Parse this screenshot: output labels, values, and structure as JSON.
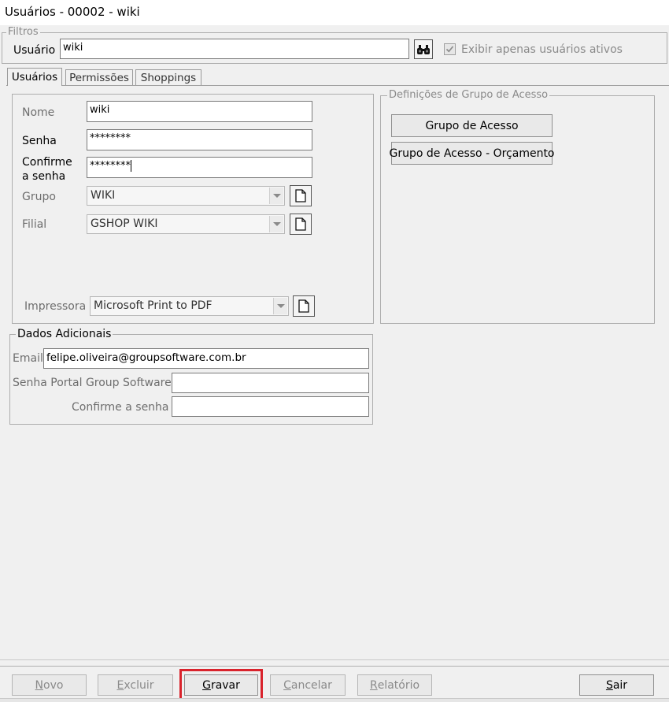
{
  "window": {
    "title": "Usuários - 00002 - wiki"
  },
  "filtros": {
    "legend": "Filtros",
    "usuario_label": "Usuário",
    "usuario_value": "wiki",
    "search_icon": "binoculars-icon",
    "checkbox_label": "Exibir apenas usuários ativos",
    "checkbox_checked": true
  },
  "tabs": [
    {
      "label": "Usuários",
      "active": true
    },
    {
      "label": "Permissões",
      "active": false
    },
    {
      "label": "Shoppings",
      "active": false
    }
  ],
  "usuario_form": {
    "nome_label": "Nome",
    "nome_value": "wiki",
    "senha_label": "Senha",
    "senha_value": "********",
    "confirme_label_line1": "Confirme",
    "confirme_label_line2": "a senha",
    "confirme_value": "********",
    "grupo_label": "Grupo",
    "grupo_value": "WIKI",
    "filial_label": "Filial",
    "filial_value": "GSHOP WIKI",
    "impressora_label": "Impressora",
    "impressora_value": "Microsoft Print to PDF",
    "new_icon": "new-document-icon"
  },
  "definicoes": {
    "legend": "Definições de Grupo de Acesso",
    "grupo_acesso_button": "Grupo de Acesso",
    "grupo_acesso_orcamento_button": "Grupo de Acesso - Orçamento"
  },
  "dados_adicionais": {
    "legend": "Dados Adicionais",
    "email_label": "Email",
    "email_value": "felipe.oliveira@groupsoftware.com.br",
    "senha_portal_label": "Senha Portal Group Software",
    "senha_portal_value": "",
    "confirme_label": "Confirme a senha",
    "confirme_value": ""
  },
  "toolbar": {
    "novo": {
      "mnemonic": "N",
      "rest": "ovo"
    },
    "excluir": {
      "mnemonic": "E",
      "rest": "xcluir"
    },
    "gravar": {
      "mnemonic": "G",
      "rest": "ravar"
    },
    "cancelar": {
      "mnemonic": "C",
      "rest": "ancelar"
    },
    "relatorio": {
      "mnemonic": "R",
      "rest": "elatório"
    },
    "sair": {
      "mnemonic": "S",
      "rest": "air"
    },
    "highlight_color": "#d9232c"
  }
}
